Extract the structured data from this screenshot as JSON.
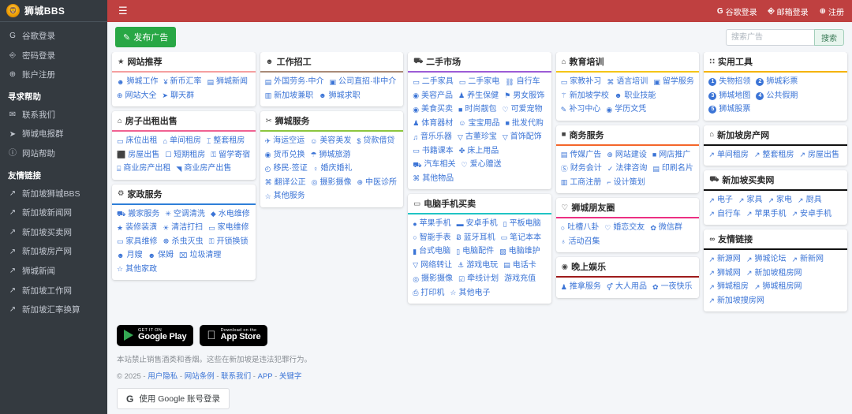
{
  "brand": {
    "title": "狮城BBS",
    "logo_icon": "lion-logo"
  },
  "topbar": {
    "menu_icon": "hamburger-icon",
    "links": [
      {
        "label": "谷歌登录",
        "icon": "google-icon"
      },
      {
        "label": "邮箱登录",
        "icon": "user-icon"
      },
      {
        "label": "注册",
        "icon": "plus-circle-icon"
      }
    ]
  },
  "sidebar": {
    "items": [
      {
        "label": "谷歌登录",
        "icon": "google-icon"
      },
      {
        "label": "密码登录",
        "icon": "user-icon"
      },
      {
        "label": "账户注册",
        "icon": "plus-circle-icon"
      }
    ],
    "help_header": "寻求帮助",
    "help_items": [
      {
        "label": "联系我们",
        "icon": "envelope-icon"
      },
      {
        "label": "狮城电报群",
        "icon": "telegram-icon"
      },
      {
        "label": "网站帮助",
        "icon": "question-circle-icon"
      }
    ],
    "links_header": "友情链接",
    "links": [
      {
        "label": "新加坡狮城BBS",
        "icon": "external-link-icon"
      },
      {
        "label": "新加坡新闻网",
        "icon": "external-link-icon"
      },
      {
        "label": "新加坡买卖网",
        "icon": "external-link-icon"
      },
      {
        "label": "新加坡房产网",
        "icon": "external-link-icon"
      },
      {
        "label": "狮城新闻",
        "icon": "external-link-icon"
      },
      {
        "label": "新加坡工作网",
        "icon": "external-link-icon"
      },
      {
        "label": "新加坡汇率换算",
        "icon": "external-link-icon"
      }
    ]
  },
  "actionbar": {
    "post_label": "发布广告",
    "post_icon": "edit-icon",
    "search_placeholder": "搜索广告",
    "search_value": "",
    "search_button": "搜索"
  },
  "columns": [
    {
      "cards": [
        {
          "title": "网站推荐",
          "icon": "star-icon",
          "rule_color": "#f5a0a0",
          "links": [
            {
              "label": "狮城工作",
              "icon": "users-icon"
            },
            {
              "label": "新币汇率",
              "icon": "yen-icon"
            },
            {
              "label": "狮城新闻",
              "icon": "newspaper-icon"
            },
            {
              "label": "网站大全",
              "icon": "globe-icon"
            },
            {
              "label": "聊天群",
              "icon": "telegram-icon"
            }
          ]
        },
        {
          "title": "房子出租出售",
          "icon": "home-icon",
          "rule_color": "#f06292",
          "links": [
            {
              "label": "床位出租",
              "icon": "bed-icon"
            },
            {
              "label": "单间租房",
              "icon": "home-icon"
            },
            {
              "label": "整套租房",
              "icon": "building-icon"
            },
            {
              "label": "房屋出售",
              "icon": "house-sale-icon"
            },
            {
              "label": "短期租房",
              "icon": "calendar-icon"
            },
            {
              "label": "留学寄宿",
              "icon": "lock-icon"
            },
            {
              "label": "商业房产出租",
              "icon": "store-icon"
            },
            {
              "label": "商业房产出售",
              "icon": "chart-icon"
            }
          ]
        },
        {
          "title": "家政服务",
          "icon": "gear-icon",
          "rule_color": "#2f7fd8",
          "links": [
            {
              "label": "搬家服务",
              "icon": "truck-icon"
            },
            {
              "label": "空调清洗",
              "icon": "snowflake-icon"
            },
            {
              "label": "水电维修",
              "icon": "water-drop-icon"
            },
            {
              "label": "装修装潢",
              "icon": "paint-icon"
            },
            {
              "label": "清洁打扫",
              "icon": "sun-icon"
            },
            {
              "label": "家电维修",
              "icon": "tv-icon"
            },
            {
              "label": "家具维修",
              "icon": "sofa-icon"
            },
            {
              "label": "杀虫灭虫",
              "icon": "bug-icon"
            },
            {
              "label": "开锁换锁",
              "icon": "key-icon"
            },
            {
              "label": "月嫂",
              "icon": "user-plus-icon"
            },
            {
              "label": "保姆",
              "icon": "user-plus-icon"
            },
            {
              "label": "垃圾清理",
              "icon": "trash-icon"
            },
            {
              "label": "其他家政",
              "icon": "star-outline-icon"
            }
          ]
        }
      ]
    },
    {
      "cards": [
        {
          "title": "工作招工",
          "icon": "users-icon",
          "rule_color": "#a98a78",
          "links": [
            {
              "label": "外国劳务·中介",
              "icon": "id-card-icon"
            },
            {
              "label": "公司直招·非中介",
              "icon": "user-square-icon"
            },
            {
              "label": "新加坡兼职",
              "icon": "portrait-icon"
            },
            {
              "label": "狮城求职",
              "icon": "user-search-icon"
            }
          ]
        },
        {
          "title": "狮城服务",
          "icon": "scissors-icon",
          "rule_color": "#8cc63e",
          "links": [
            {
              "label": "海运空运",
              "icon": "plane-icon"
            },
            {
              "label": "美容美发",
              "icon": "smile-icon"
            },
            {
              "label": "贷款借贷",
              "icon": "dollar-icon"
            },
            {
              "label": "货币兑换",
              "icon": "coins-icon"
            },
            {
              "label": "狮城旅游",
              "icon": "umbrella-icon"
            },
            {
              "label": "移民·签证",
              "icon": "clock-icon"
            },
            {
              "label": "婚庆婚礼",
              "icon": "ring-icon"
            },
            {
              "label": "翻译公正",
              "icon": "language-icon"
            },
            {
              "label": "摄影摄像",
              "icon": "camera-icon"
            },
            {
              "label": "中医诊所",
              "icon": "medical-icon"
            },
            {
              "label": "其他服务",
              "icon": "star-outline-icon"
            }
          ]
        }
      ]
    },
    {
      "cards": [
        {
          "title": "二手市场",
          "icon": "cart-icon",
          "rule_color": "#9c5cd6",
          "links": [
            {
              "label": "二手家具",
              "icon": "sofa-icon"
            },
            {
              "label": "二手家电",
              "icon": "tv-icon"
            },
            {
              "label": "自行车",
              "icon": "bicycle-icon"
            },
            {
              "label": "美容产品",
              "icon": "circle-icon"
            },
            {
              "label": "养生保健",
              "icon": "person-icon"
            },
            {
              "label": "男女服饰",
              "icon": "tag-icon"
            },
            {
              "label": "美食买卖",
              "icon": "dot-circle-icon"
            },
            {
              "label": "时尚靓包",
              "icon": "bag-icon"
            },
            {
              "label": "可爱宠物",
              "icon": "paw-icon"
            },
            {
              "label": "体育器材",
              "icon": "runner-icon"
            },
            {
              "label": "宝宝用品",
              "icon": "baby-icon"
            },
            {
              "label": "批发代购",
              "icon": "briefcase-icon"
            },
            {
              "label": "音乐乐器",
              "icon": "music-icon"
            },
            {
              "label": "古董珍宝",
              "icon": "gem-icon"
            },
            {
              "label": "首饰配饰",
              "icon": "gem-icon"
            },
            {
              "label": "书籍课本",
              "icon": "book-icon"
            },
            {
              "label": "床上用品",
              "icon": "bedding-icon"
            },
            {
              "label": "汽车相关",
              "icon": "car-icon"
            },
            {
              "label": "爱心赠送",
              "icon": "heart-icon"
            },
            {
              "label": "其他物品",
              "icon": "boxes-icon"
            }
          ]
        },
        {
          "title": "电脑手机买卖",
          "icon": "monitor-icon",
          "rule_color": "#20c4c4",
          "links": [
            {
              "label": "苹果手机",
              "icon": "apple-icon"
            },
            {
              "label": "安卓手机",
              "icon": "android-icon"
            },
            {
              "label": "平板电脑",
              "icon": "tablet-icon"
            },
            {
              "label": "智能手表",
              "icon": "watch-icon"
            },
            {
              "label": "蓝牙耳机",
              "icon": "bluetooth-icon"
            },
            {
              "label": "笔记本本",
              "icon": "laptop-icon"
            },
            {
              "label": "台式电脑",
              "icon": "desktop-icon"
            },
            {
              "label": "电脑配件",
              "icon": "chip-icon"
            },
            {
              "label": "电脑维护",
              "icon": "tools-icon"
            },
            {
              "label": "网络转让",
              "icon": "wifi-icon"
            },
            {
              "label": "游戏电玩",
              "icon": "gamepad-icon"
            },
            {
              "label": "电话卡",
              "icon": "sim-icon"
            },
            {
              "label": "摄影摄像",
              "icon": "camera-icon"
            },
            {
              "label": "牵线计划",
              "icon": "checkbox-icon"
            },
            {
              "label": "游戏充值",
              "icon": "none"
            },
            {
              "label": "打印机",
              "icon": "printer-icon"
            },
            {
              "label": "其他电子",
              "icon": "star-outline-icon"
            }
          ]
        }
      ]
    },
    {
      "cards": [
        {
          "title": "教育培训",
          "icon": "graduation-icon",
          "rule_color": "#f5c518",
          "links": [
            {
              "label": "家教补习",
              "icon": "book-icon"
            },
            {
              "label": "语言培训",
              "icon": "language-icon"
            },
            {
              "label": "留学服务",
              "icon": "window-icon"
            },
            {
              "label": "新加坡学校",
              "icon": "school-icon"
            },
            {
              "label": "职业技能",
              "icon": "user-search-icon"
            },
            {
              "label": "补习中心",
              "icon": "pen-icon"
            },
            {
              "label": "学历文凭",
              "icon": "certificate-icon"
            }
          ]
        },
        {
          "title": "商务服务",
          "icon": "briefcase-icon",
          "rule_color": "#f4662a",
          "links": [
            {
              "label": "传媒广告",
              "icon": "ad-icon"
            },
            {
              "label": "网站建设",
              "icon": "globe-icon"
            },
            {
              "label": "网店推广",
              "icon": "shop-icon"
            },
            {
              "label": "财务会计",
              "icon": "money-icon"
            },
            {
              "label": "法律咨询",
              "icon": "scale-icon"
            },
            {
              "label": "印刷名片",
              "icon": "card-icon"
            },
            {
              "label": "工商注册",
              "icon": "register-icon"
            },
            {
              "label": "设计策划",
              "icon": "design-icon"
            }
          ]
        },
        {
          "title": "狮城朋友圈",
          "icon": "heart-icon",
          "rule_color": "#ec2f82",
          "links": [
            {
              "label": "吐槽八卦",
              "icon": "comment-icon"
            },
            {
              "label": "婚恋交友",
              "icon": "heart-icon"
            },
            {
              "label": "微信群",
              "icon": "wechat-icon"
            },
            {
              "label": "活动召集",
              "icon": "bell-icon"
            }
          ]
        },
        {
          "title": "晚上娱乐",
          "icon": "dot-circle-icon",
          "rule_color": "#9e1b1b",
          "links": [
            {
              "label": "推拿服务",
              "icon": "person-icon"
            },
            {
              "label": "大人用品",
              "icon": "venus-mars-icon"
            },
            {
              "label": "一夜快乐",
              "icon": "wechat-icon"
            }
          ]
        }
      ]
    },
    {
      "cards": [
        {
          "title": "实用工具",
          "icon": "grid-icon",
          "rule_color": "#f5b301",
          "links": [
            {
              "label": "失物招领",
              "icon": "num-1"
            },
            {
              "label": "狮城彩票",
              "icon": "num-2"
            },
            {
              "label": "狮城地图",
              "icon": "num-3"
            },
            {
              "label": "公共假期",
              "icon": "num-4"
            },
            {
              "label": "狮城股票",
              "icon": "num-5"
            }
          ]
        },
        {
          "title": "新加坡房产网",
          "icon": "home-icon",
          "rule_color": "#111111",
          "links": [
            {
              "label": "单间租房",
              "icon": "external-link-icon"
            },
            {
              "label": "整套租房",
              "icon": "external-link-icon"
            },
            {
              "label": "房屋出售",
              "icon": "external-link-icon"
            }
          ]
        },
        {
          "title": "新加坡买卖网",
          "icon": "cart-icon",
          "rule_color": "#111111",
          "links": [
            {
              "label": "电子",
              "icon": "external-link-icon"
            },
            {
              "label": "家具",
              "icon": "external-link-icon"
            },
            {
              "label": "家电",
              "icon": "external-link-icon"
            },
            {
              "label": "厨具",
              "icon": "external-link-icon"
            },
            {
              "label": "自行车",
              "icon": "external-link-icon"
            },
            {
              "label": "苹果手机",
              "icon": "external-link-icon"
            },
            {
              "label": "安卓手机",
              "icon": "external-link-icon"
            }
          ]
        },
        {
          "title": "友情链接",
          "icon": "link-icon",
          "rule_color": "#111111",
          "links": [
            {
              "label": "新源网",
              "icon": "external-link-icon"
            },
            {
              "label": "狮城论坛",
              "icon": "external-link-icon"
            },
            {
              "label": "新新网",
              "icon": "external-link-icon"
            },
            {
              "label": "狮城网",
              "icon": "external-link-icon"
            },
            {
              "label": "新加坡租房网",
              "icon": "external-link-icon"
            },
            {
              "label": "狮城租房",
              "icon": "external-link-icon"
            },
            {
              "label": "狮城租房网",
              "icon": "external-link-icon"
            },
            {
              "label": "新加坡搜房网",
              "icon": "external-link-icon"
            }
          ]
        }
      ]
    }
  ],
  "footer": {
    "google_play": {
      "small": "GET IT ON",
      "big": "Google Play",
      "icon": "google-play-icon"
    },
    "app_store": {
      "small": "Download on the",
      "big": "App Store",
      "icon": "apple-icon"
    },
    "disclaimer": "本站禁止销售酒类和香烟。这些在新加坡是违法犯罪行为。",
    "copyright": "© 2025 -",
    "copy_links": [
      "用户隐私",
      "网站条例",
      "联系我们",
      "APP",
      "关键字"
    ],
    "copy_sep": "-",
    "google_signin": {
      "label": "使用 Google 账号登录",
      "icon": "google-icon"
    }
  }
}
